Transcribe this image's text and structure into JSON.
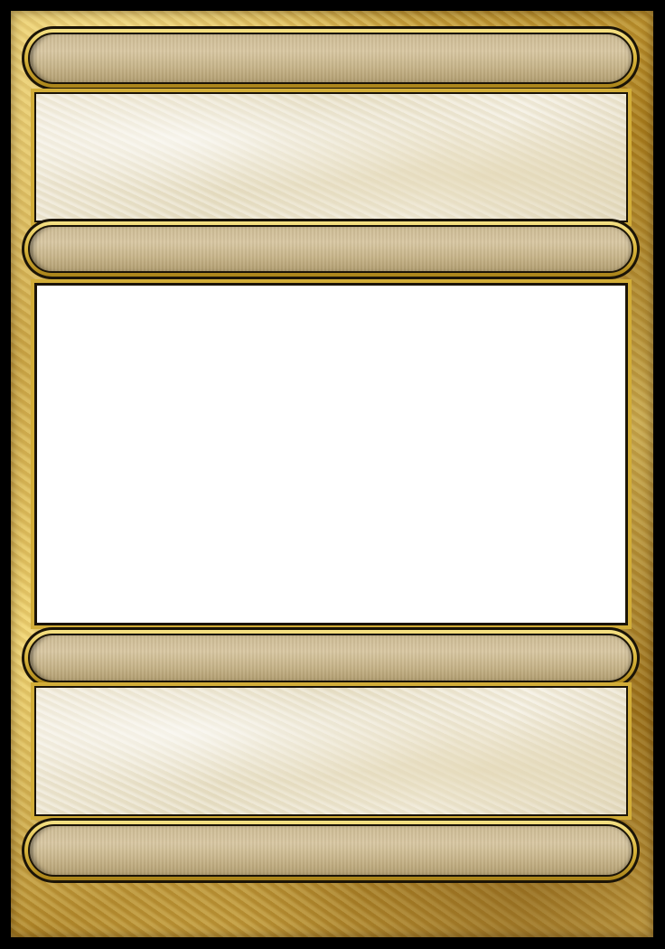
{
  "card": {
    "title": "",
    "type_line": "",
    "effect_text": "",
    "footer": ""
  },
  "colors": {
    "outer_border": "#000000",
    "gold": "#d2ad38",
    "bar_fill": "#cdbb94",
    "panel_fill": "#ece4cf",
    "art_window": "#ffffff"
  }
}
